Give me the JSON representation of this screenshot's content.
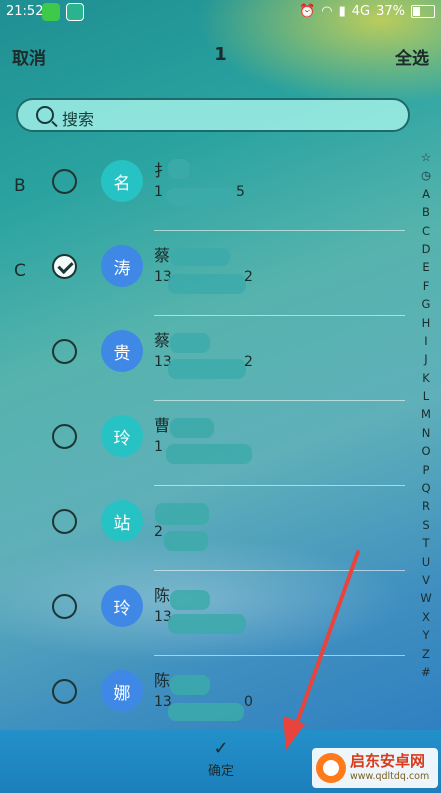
{
  "status": {
    "time": "21:52",
    "network": "4G",
    "battery": "37%"
  },
  "header": {
    "cancel": "取消",
    "count": "1",
    "select_all": "全选"
  },
  "search": {
    "placeholder": "搜索"
  },
  "contacts": [
    {
      "section": "B",
      "avatar": "名",
      "name": "扌",
      "phone": "1",
      "phone_tail": "5",
      "checked": false,
      "color": "#27c2c4"
    },
    {
      "section": "C",
      "avatar": "涛",
      "name": "蔡",
      "phone": "13",
      "phone_tail": "2",
      "checked": true,
      "color": "#3f88e6"
    },
    {
      "section": "",
      "avatar": "贵",
      "name": "蔡",
      "phone": "13",
      "phone_tail": "2",
      "checked": false,
      "color": "#3f88e6"
    },
    {
      "section": "",
      "avatar": "玲",
      "name": "曹",
      "phone": "1",
      "phone_tail": "",
      "checked": false,
      "color": "#27c2c4"
    },
    {
      "section": "",
      "avatar": "站",
      "name": "",
      "phone": "2",
      "phone_tail": "",
      "checked": false,
      "color": "#27c2c4"
    },
    {
      "section": "",
      "avatar": "玲",
      "name": "陈",
      "phone": "13",
      "phone_tail": "",
      "checked": false,
      "color": "#3f88e6"
    },
    {
      "section": "",
      "avatar": "娜",
      "name": "陈",
      "phone": "13",
      "phone_tail": "0",
      "checked": false,
      "color": "#3f88e6"
    }
  ],
  "index_letters": [
    "☆",
    "◷",
    "A",
    "B",
    "C",
    "D",
    "E",
    "F",
    "G",
    "H",
    "I",
    "J",
    "K",
    "L",
    "M",
    "N",
    "O",
    "P",
    "Q",
    "R",
    "S",
    "T",
    "U",
    "V",
    "W",
    "X",
    "Y",
    "Z",
    "#"
  ],
  "bottom": {
    "confirm": "确定"
  },
  "watermark": {
    "title": "启东安卓网",
    "url": "www.qdltdq.com"
  }
}
